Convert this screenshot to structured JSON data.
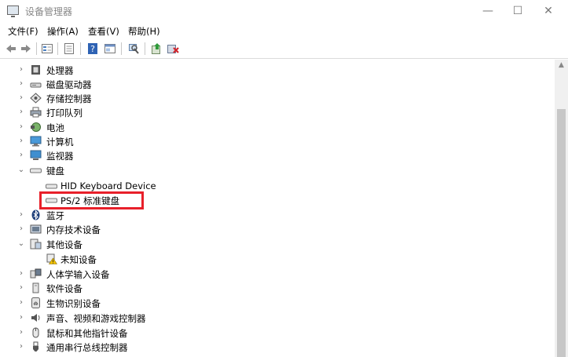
{
  "window": {
    "title": "设备管理器",
    "minimize": "—",
    "maximize": "☐",
    "close": "✕"
  },
  "menu": [
    "文件(F)",
    "操作(A)",
    "查看(V)",
    "帮助(H)"
  ],
  "toolbar": [
    "back-icon",
    "forward-icon",
    "properties-view-icon",
    "console-icon",
    "help-icon",
    "details-icon",
    "scan-hardware-icon",
    "update-driver-icon",
    "uninstall-icon"
  ],
  "tree": [
    {
      "label": "处理器",
      "expanded": false,
      "icon": "processor-icon"
    },
    {
      "label": "磁盘驱动器",
      "expanded": false,
      "icon": "disk-drive-icon"
    },
    {
      "label": "存储控制器",
      "expanded": false,
      "icon": "storage-controller-icon"
    },
    {
      "label": "打印队列",
      "expanded": false,
      "icon": "print-queue-icon"
    },
    {
      "label": "电池",
      "expanded": false,
      "icon": "battery-icon"
    },
    {
      "label": "计算机",
      "expanded": false,
      "icon": "computer-icon"
    },
    {
      "label": "监视器",
      "expanded": false,
      "icon": "monitor-icon"
    },
    {
      "label": "键盘",
      "expanded": true,
      "icon": "keyboard-icon",
      "children": [
        {
          "label": "HID Keyboard Device",
          "icon": "keyboard-icon"
        },
        {
          "label": "PS/2 标准键盘",
          "icon": "keyboard-icon",
          "highlighted": true
        }
      ]
    },
    {
      "label": "蓝牙",
      "expanded": false,
      "icon": "bluetooth-icon"
    },
    {
      "label": "内存技术设备",
      "expanded": false,
      "icon": "memory-device-icon"
    },
    {
      "label": "其他设备",
      "expanded": true,
      "icon": "other-devices-icon",
      "children": [
        {
          "label": "未知设备",
          "icon": "unknown-device-warning-icon"
        }
      ]
    },
    {
      "label": "人体学输入设备",
      "expanded": false,
      "icon": "hid-icon"
    },
    {
      "label": "软件设备",
      "expanded": false,
      "icon": "software-device-icon"
    },
    {
      "label": "生物识别设备",
      "expanded": false,
      "icon": "biometric-icon"
    },
    {
      "label": "声音、视频和游戏控制器",
      "expanded": false,
      "icon": "sound-icon"
    },
    {
      "label": "鼠标和其他指针设备",
      "expanded": false,
      "icon": "mouse-icon"
    },
    {
      "label": "通用串行总线控制器",
      "expanded": false,
      "icon": "usb-icon"
    }
  ],
  "colors": {
    "highlight_border": "#e8202a"
  }
}
